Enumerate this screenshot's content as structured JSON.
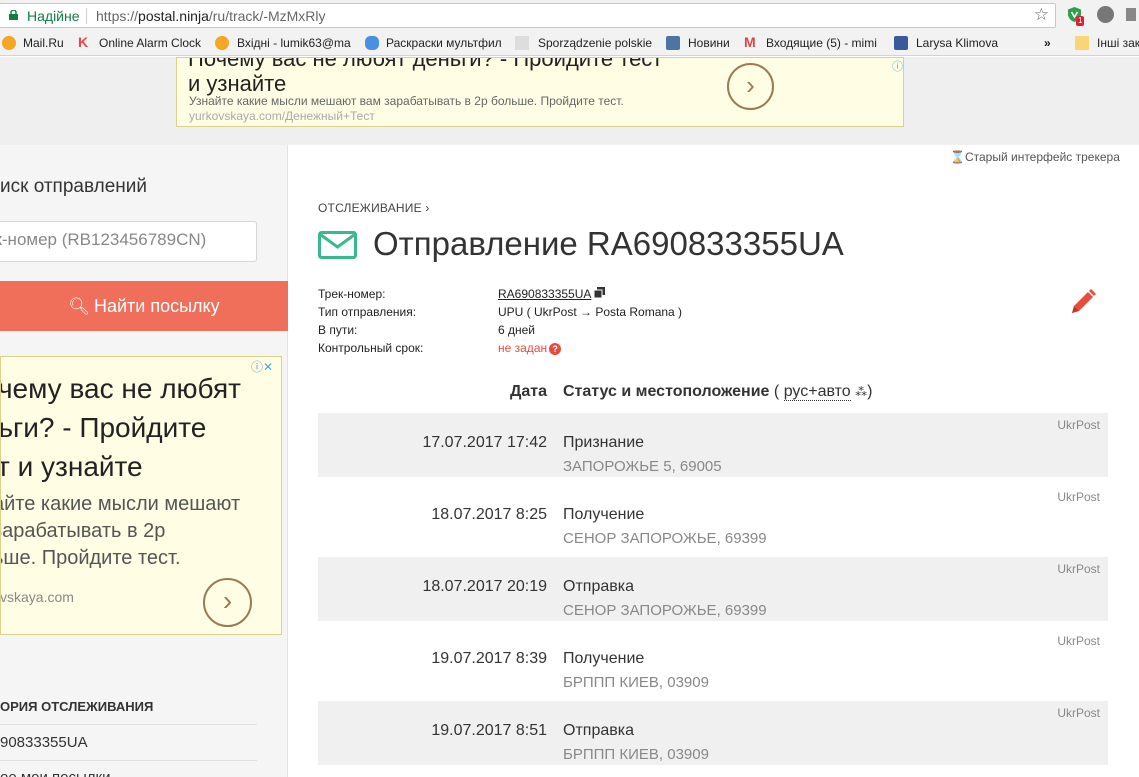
{
  "browser": {
    "secure_label": "Надійне",
    "url_scheme": "https://",
    "url_host": "postal.ninja",
    "url_path": "/ru/track/-MzMxRly",
    "bookmarks": [
      {
        "label": "Mail.Ru",
        "icon": "mailru-icon"
      },
      {
        "label": "Online Alarm Clock",
        "icon": "k-icon"
      },
      {
        "label": "Вхідні - lumik63@ma",
        "icon": "mailru-icon"
      },
      {
        "label": "Раскраски мультфил",
        "icon": "feet-icon"
      },
      {
        "label": "Sporządzenie polskie",
        "icon": "eagle-icon"
      },
      {
        "label": "Новини",
        "icon": "vk-icon"
      },
      {
        "label": "Входящие (5) - mimi",
        "icon": "gmail-icon"
      },
      {
        "label": "Larysa Klimova",
        "icon": "facebook-icon"
      },
      {
        "label": "»",
        "icon": ""
      },
      {
        "label": "Інші зак",
        "icon": "folder-icon"
      }
    ]
  },
  "top_ad": {
    "headline_line1": "Почему вас не любят деньги? - Пройдите тест",
    "headline_line2": "и узнайте",
    "description": "Узнайте какие мысли мешают вам зарабатывать в 2р больше. Пройдите тест.",
    "domain": "yurkovskaya.com/Денежный+Тест",
    "arrow": "›"
  },
  "sidebar": {
    "search_title": "иск отправлений",
    "search_placeholder": "ек-номер (RB123456789CN)",
    "find_button": "Найти посылку",
    "ad": {
      "headline_line1": "очему вас не любят",
      "headline_line2": "ньги? - Пройдите",
      "headline_line3": "ст и узнайте",
      "desc_line1": "айте какие мысли мешают",
      "desc_line2": "зарабатывать в 2р",
      "desc_line3": "ьше. Пройдите тест.",
      "domain": "vskaya.com",
      "arrow": "›"
    },
    "history_title": "ОРИЯ ОТСЛЕЖИВАНИЯ",
    "history_item": "90833355UA",
    "history_item2": "ое мои посылки"
  },
  "main": {
    "old_interface": "Старый интерфейс трекера",
    "breadcrumb": "ОТСЛЕЖИВАНИЕ",
    "breadcrumb_arrow": "›",
    "title": "Отправление RA690833355UA",
    "info": {
      "track_label": "Трек-номер:",
      "track_value": "RA690833355UA",
      "type_label": "Тип отправления:",
      "type_value": "UPU ( UkrPost → Posta Romana )",
      "transit_label": "В пути:",
      "transit_value": "6 дней",
      "deadline_label": "Контрольный срок:",
      "deadline_value": "не задан",
      "help": "?"
    },
    "table": {
      "date_header": "Дата",
      "status_header": "Статус и местоположение",
      "lang_link": "рус+авто",
      "paren_open": "(",
      "paren_close": ")"
    },
    "events": [
      {
        "date": "17.07.2017 17:42",
        "status": "Признание",
        "location": "ЗАПОРОЖЬЕ 5, 69005",
        "source": "UkrPost"
      },
      {
        "date": "18.07.2017 8:25",
        "status": "Получение",
        "location": "СЕНОР ЗАПОРОЖЬЕ, 69399",
        "source": "UkrPost"
      },
      {
        "date": "18.07.2017 20:19",
        "status": "Отправка",
        "location": "СЕНОР ЗАПОРОЖЬЕ, 69399",
        "source": "UkrPost"
      },
      {
        "date": "19.07.2017 8:39",
        "status": "Получение",
        "location": "БРППП КИЕВ, 03909",
        "source": "UkrPost"
      },
      {
        "date": "19.07.2017 8:51",
        "status": "Отправка",
        "location": "БРППП КИЕВ, 03909",
        "source": "UkrPost"
      }
    ]
  },
  "colors": {
    "accent_red": "#ef6f5a",
    "envelope_green": "#3bb88f",
    "secure_green": "#0b8043"
  }
}
